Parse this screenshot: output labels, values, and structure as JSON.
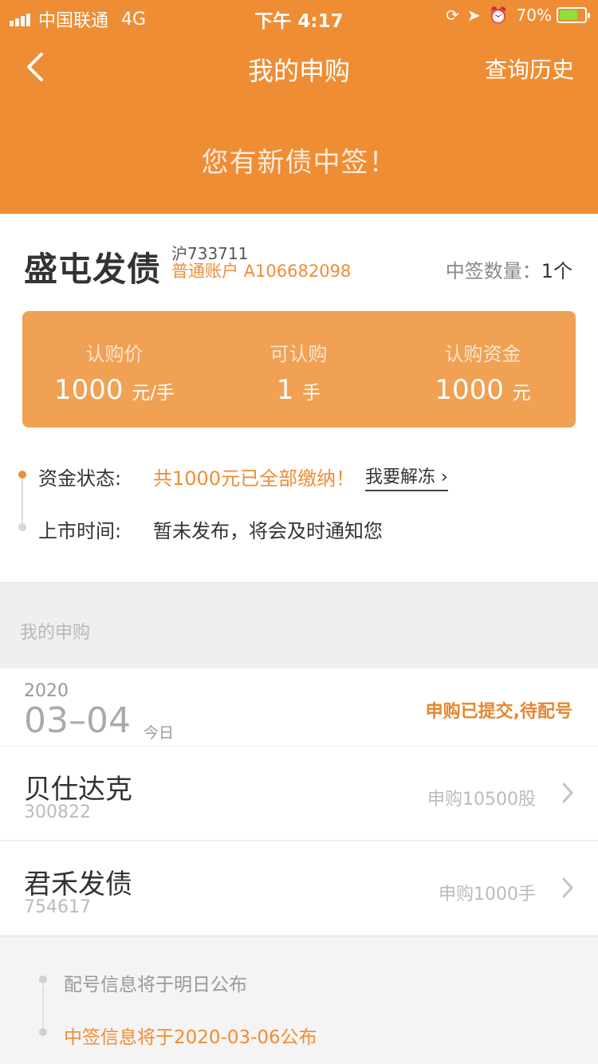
{
  "status_bar": {
    "carrier": "中国联通",
    "network": "4G",
    "time": "下午 4:17",
    "battery": "70%"
  },
  "nav": {
    "title": "我的申购",
    "right_link": "查询历史"
  },
  "banner": "您有新债中签！",
  "bond": {
    "name": "盛屯发债",
    "code": "沪733711",
    "account": "普通账户 A106682098",
    "win_label": "中签数量：",
    "win_value": "1个",
    "price_label": "认购价",
    "price_value": "1000",
    "price_unit": "元/手",
    "qty_label": "可认购",
    "qty_value": "1",
    "qty_unit": "手",
    "fund_label": "认购资金",
    "fund_value": "1000",
    "fund_unit": "元"
  },
  "timeline": {
    "fund_status_label": "资金状态:",
    "fund_status_value": "共1000元已全部缴纳！",
    "unfreeze_link": "我要解冻 ›",
    "listing_label": "上市时间:",
    "listing_value": "暂未发布，将会及时通知您"
  },
  "section_title": "我的申购",
  "date_group": {
    "year": "2020",
    "month_day": "03–04",
    "today": "今日",
    "status": "申购已提交,待配号"
  },
  "items": [
    {
      "name": "贝仕达克",
      "code": "300822",
      "amount": "申购10500股"
    },
    {
      "name": "君禾发债",
      "code": "754617",
      "amount": "申购1000手"
    }
  ],
  "footer": {
    "line1": "配号信息将于明日公布",
    "line2": "中签信息将于2020-03-06公布"
  },
  "colors": {
    "brand_orange": "#ef8d34",
    "box_orange": "#f0a153",
    "highlight": "#e8852e"
  }
}
